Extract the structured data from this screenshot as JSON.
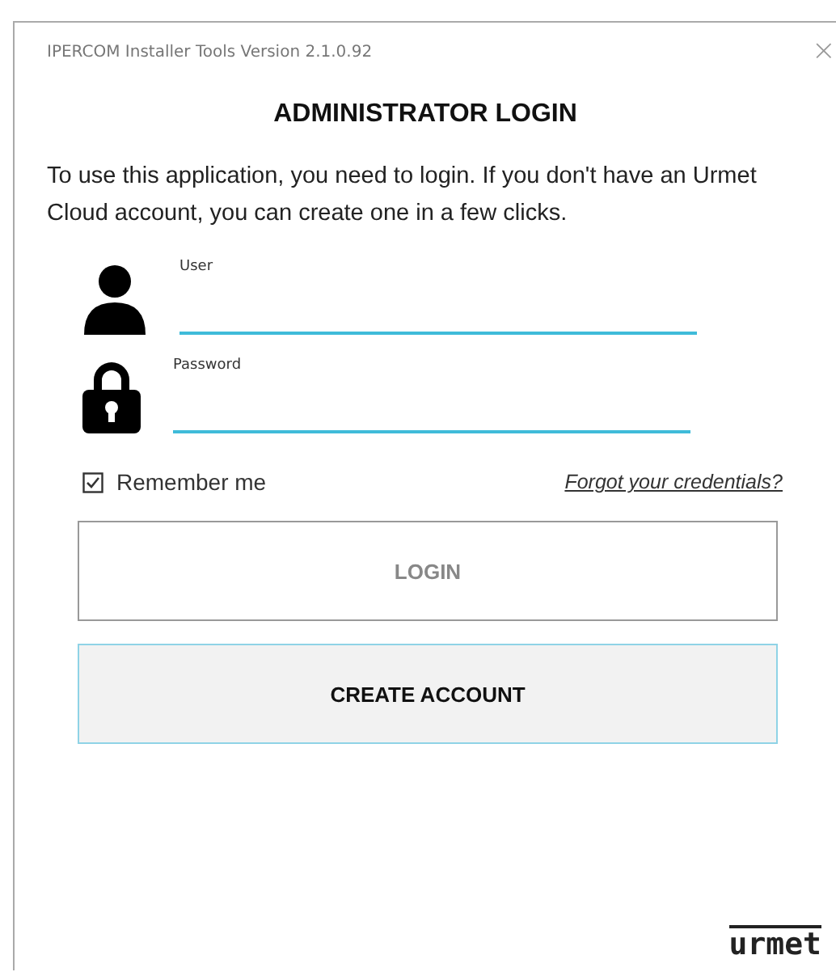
{
  "window": {
    "title": "IPERCOM Installer Tools Version 2.1.0.92",
    "close": "×"
  },
  "heading": "ADMINISTRATOR LOGIN",
  "intro": "To use this application, you need to login. If you don't have an Urmet Cloud account, you can create one in a few clicks.",
  "fields": [
    {
      "kind": "user",
      "label": "User"
    },
    {
      "kind": "password",
      "label": "Password"
    }
  ],
  "remember": {
    "label": "Remember me",
    "checked": true
  },
  "forgot_link": "Forgot your credentials?",
  "buttons": [
    {
      "label": "LOGIN",
      "kind": "outline"
    },
    {
      "label": "CREATE ACCOUNT",
      "kind": "filled"
    }
  ],
  "logo": "urmet"
}
